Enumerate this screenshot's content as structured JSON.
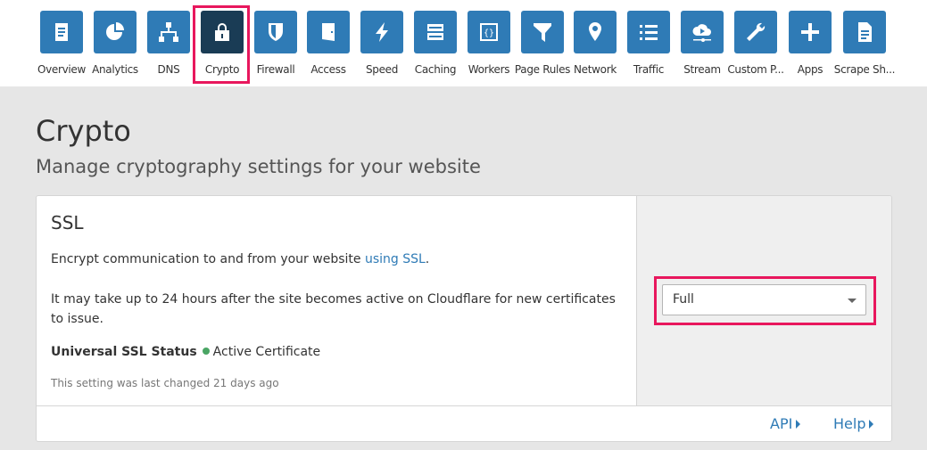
{
  "nav": {
    "items": [
      {
        "label": "Overview",
        "icon": "clipboard-icon"
      },
      {
        "label": "Analytics",
        "icon": "pie-chart-icon"
      },
      {
        "label": "DNS",
        "icon": "network-tree-icon"
      },
      {
        "label": "Crypto",
        "icon": "lock-icon",
        "active": true
      },
      {
        "label": "Firewall",
        "icon": "shield-icon"
      },
      {
        "label": "Access",
        "icon": "door-icon"
      },
      {
        "label": "Speed",
        "icon": "lightning-icon"
      },
      {
        "label": "Caching",
        "icon": "server-icon"
      },
      {
        "label": "Workers",
        "icon": "code-braces-icon"
      },
      {
        "label": "Page Rules",
        "icon": "filter-icon"
      },
      {
        "label": "Network",
        "icon": "map-pin-icon"
      },
      {
        "label": "Traffic",
        "icon": "list-icon"
      },
      {
        "label": "Stream",
        "icon": "cloud-play-icon"
      },
      {
        "label": "Custom P...",
        "icon": "wrench-icon"
      },
      {
        "label": "Apps",
        "icon": "plus-icon"
      },
      {
        "label": "Scrape Sh...",
        "icon": "document-icon"
      }
    ]
  },
  "page": {
    "title": "Crypto",
    "subtitle": "Manage cryptography settings for your website"
  },
  "ssl": {
    "title": "SSL",
    "desc_prefix": "Encrypt communication to and from your website ",
    "desc_link": "using SSL",
    "desc_suffix": ".",
    "note": "It may take up to 24 hours after the site becomes active on Cloudflare for new certificates to issue.",
    "status_label": "Universal SSL Status",
    "status_value": "Active Certificate",
    "status_color": "#4aa564",
    "last_changed": "This setting was last changed 21 days ago",
    "mode": "Full"
  },
  "footer": {
    "api": "API",
    "help": "Help"
  },
  "colors": {
    "accent": "#2f7bb6",
    "active_tile": "#1a3c55",
    "highlight": "#e8175d"
  }
}
